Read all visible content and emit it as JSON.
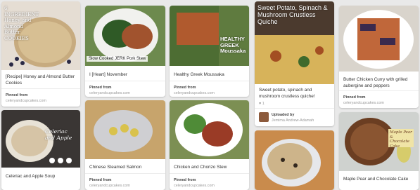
{
  "pins": [
    {
      "title": "[Recipe] Honey and Almond Butter Cookies",
      "source_label": "Pinned from",
      "source": "celeryandcupcakes.com",
      "overlay": "6 INGREDIENT Honey and Almond Butter COOKIES"
    },
    {
      "title": "Celeriac and Apple Soup",
      "overlay": "Celeriac and Apple"
    },
    {
      "title": "I [Heart] November",
      "source_label": "Pinned from",
      "source": "celeryandcupcakes.com",
      "overlay": "Slow Cooked JERK Pork Stew"
    },
    {
      "title": "Chinese Steamed Salmon",
      "source_label": "Pinned from",
      "source": "celeryandcupcakes.com"
    },
    {
      "title": "Healthy Greek Moussaka",
      "source_label": "Pinned from",
      "source": "celeryandcupcakes.com",
      "overlay": "HEALTHY GREEK Moussaka"
    },
    {
      "title": "Chicken and Chorizo Stew",
      "source_label": "Pinned from",
      "source": "celeryandcupcakes.com"
    },
    {
      "title": "Sweet potato, spinach and mushroom crustless quiche!",
      "likes": "♥ 1",
      "uploader_label": "Uploaded by",
      "uploader": "Jemima Andrew-Adamah",
      "overlay": "Sweet Potato, Spinach & Mushroom Crustless Quiche"
    },
    {
      "title": "Butter Chicken Curry with grilled aubergine and peppers",
      "source_label": "Pinned from",
      "source": "celeryandcupcakes.com"
    },
    {
      "title": "Maple Pear and Chocolate Cake",
      "overlay": "Maple Pear & Chocolate Cake"
    }
  ]
}
